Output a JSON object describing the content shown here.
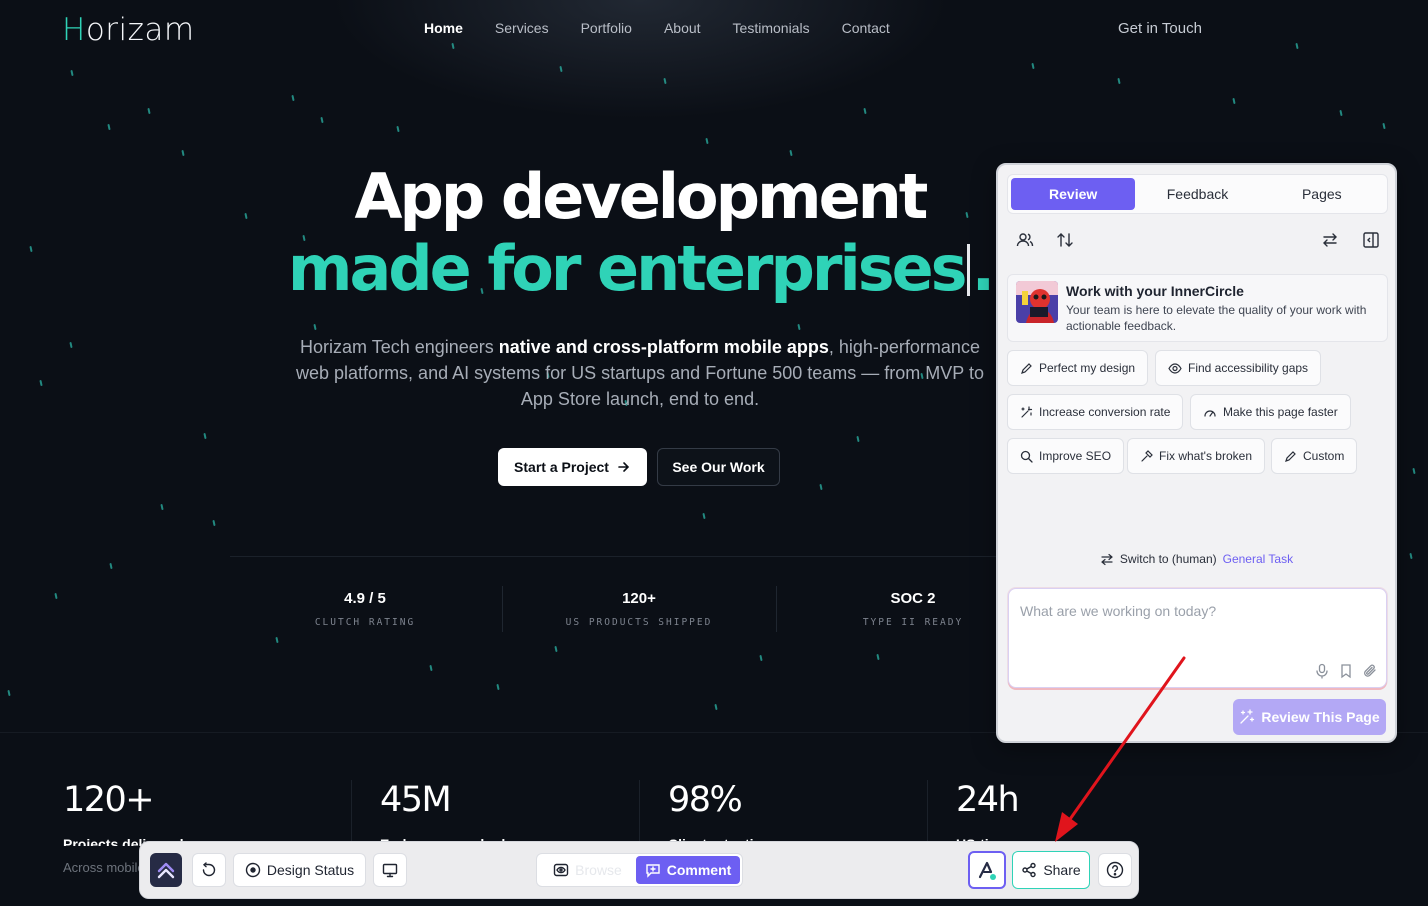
{
  "nav": {
    "logo_first": "H",
    "logo_rest": "orizam",
    "items": [
      "Home",
      "Services",
      "Portfolio",
      "About",
      "Testimonials",
      "Contact"
    ],
    "cta": "Get in Touch"
  },
  "hero": {
    "title_line1": "App development",
    "title_line2": "made for enterprises",
    "title_end": ".",
    "desc_part1": "Horizam Tech engineers ",
    "desc_bold": "native and cross-platform mobile apps",
    "desc_part2": ", high-performance web platforms, and AI systems for US startups and Fortune 500 teams — from MVP to App Store launch, end to end.",
    "primary_cta": "Start a Project",
    "secondary_cta": "See Our Work"
  },
  "mini_stats": [
    {
      "value": "4.9 / 5",
      "label": "CLUTCH RATING"
    },
    {
      "value": "120+",
      "label": "US PRODUCTS SHIPPED"
    },
    {
      "value": "SOC 2",
      "label": "TYPE II READY"
    }
  ],
  "big_stats": [
    {
      "value": "120+",
      "label": "Projects delivered",
      "sub": "Across mobile"
    },
    {
      "value": "45M",
      "label": "End users reached",
      "sub": ""
    },
    {
      "value": "98%",
      "label": "Client retention",
      "sub": ""
    },
    {
      "value": "24h",
      "label": "US-time response",
      "sub": ""
    }
  ],
  "panel": {
    "tabs": [
      "Review",
      "Feedback",
      "Pages"
    ],
    "intro_title": "Work with your InnerCircle",
    "intro_text": "Your team is here to elevate the quality of your work with actionable feedback.",
    "chips": [
      "Perfect my design",
      "Find accessibility gaps",
      "Increase conversion rate",
      "Make this page faster",
      "Improve SEO",
      "Fix what's broken",
      "Custom"
    ],
    "switch_text": "Switch to (human)",
    "switch_link": "General Task",
    "prompt_placeholder": "What are we working on today?",
    "review_button": "Review This Page",
    "accent": "#6d5ff2"
  },
  "toolbar": {
    "design_status": "Design Status",
    "browse": "Browse",
    "comment": "Comment",
    "share": "Share"
  },
  "colors": {
    "brand_teal": "#2fd3b7",
    "background": "#0b0f16",
    "annotation_arrow": "#e0141c"
  }
}
